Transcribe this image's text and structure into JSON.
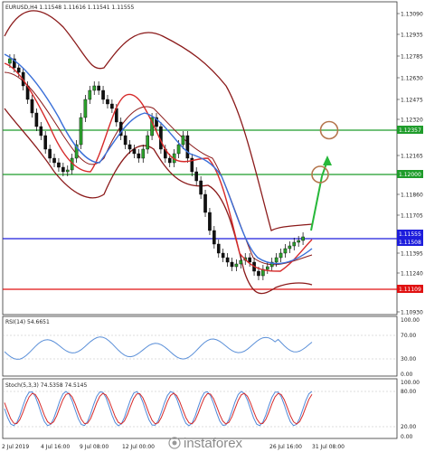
{
  "header": {
    "symbol_line": "EURUSD,H4  1.11548 1.11616 1.11541 1.11555"
  },
  "price_axis": {
    "ticks": [
      "1.13090",
      "1.12935",
      "1.12785",
      "1.12630",
      "1.12475",
      "1.12320",
      "1.12165",
      "1.11860",
      "1.11705",
      "1.11395",
      "1.11240",
      "1.10930"
    ]
  },
  "levels": {
    "green_upper": "1.12357",
    "green_lower": "1.12000",
    "blue": "1.11508",
    "blue_current": "1.11555",
    "red": "1.11109"
  },
  "rsi": {
    "label": "RSI(14) 54.6651",
    "ticks": [
      "100.00",
      "70.00",
      "30.00",
      "0.00"
    ]
  },
  "stoch": {
    "label": "Stoch(5,3,3) 74.5358 74.5145",
    "ticks": [
      "100.00",
      "80.00",
      "20.00",
      "0.00"
    ]
  },
  "time_axis": {
    "labels": [
      "2 Jul 2019",
      "4 Jul 16:00",
      "9 Jul 08:00",
      "12 Jul 00:00",
      "26 Jul 16:00",
      "31 Jul 08:00"
    ]
  },
  "watermark": {
    "brand": "instaforex"
  },
  "colors": {
    "bollinger": "#8b1a1a",
    "ema_fast": "#d62a2a",
    "ema_slow": "#3a6fd8",
    "green_level": "#1f9c2b",
    "blue_level": "#1d1ddc",
    "red_level": "#e01111",
    "arrow": "#27b83a",
    "circle": "#b5764d"
  }
}
